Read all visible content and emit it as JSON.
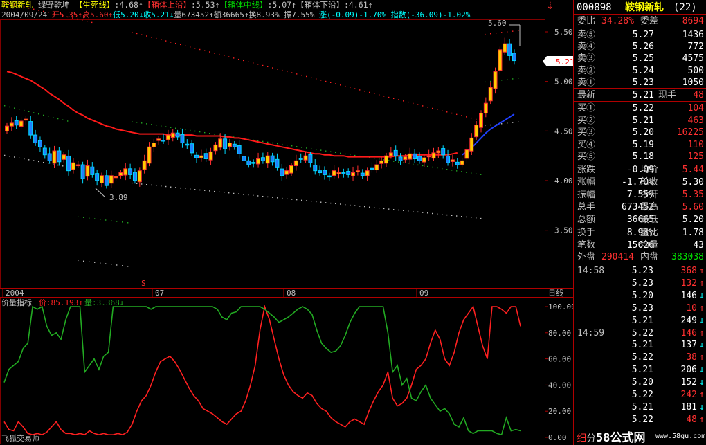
{
  "header": {
    "line1": [
      {
        "t": "鞍钢新轧",
        "c": "#ffff00"
      },
      {
        "t": "  绿野乾坤 ",
        "c": "#c0c0c0"
      },
      {
        "t": "【生死线】",
        "c": "#ffff00"
      },
      {
        "t": ":4.68↑",
        "c": "#c0c0c0"
      },
      {
        "t": "【箱体上沿】",
        "c": "#ff3030"
      },
      {
        "t": ":5.53↑",
        "c": "#c0c0c0"
      },
      {
        "t": "【箱体中线】",
        "c": "#00e000"
      },
      {
        "t": ":5.07↑",
        "c": "#c0c0c0"
      },
      {
        "t": "【箱体下沿】",
        "c": "#c0c0c0"
      },
      {
        "t": ":4.61↑",
        "c": "#c0c0c0"
      }
    ],
    "line2": [
      {
        "t": "2004/09/24 ",
        "c": "#c0c0c0"
      },
      {
        "t": "开5.35↑",
        "c": "#ff3030"
      },
      {
        "t": "高5.60↑",
        "c": "#ff3030"
      },
      {
        "t": "低5.20↓",
        "c": "#00ffff"
      },
      {
        "t": "收5.21↓",
        "c": "#00ffff"
      },
      {
        "t": "量673452↑",
        "c": "#c0c0c0"
      },
      {
        "t": "额36665↑",
        "c": "#c0c0c0"
      },
      {
        "t": "换8.93%",
        "c": "#c0c0c0"
      },
      {
        "t": " 振7.55%",
        "c": "#c0c0c0"
      },
      {
        "t": " 涨(-0.09)-1.70%",
        "c": "#00ffff"
      },
      {
        "t": " 指数(-36.09)-1.02%",
        "c": "#00ffff"
      }
    ]
  },
  "chart_data": [
    {
      "type": "candlestick",
      "title": "鞍钢新轧",
      "xlabel": "",
      "ylabel": "",
      "ylim": [
        3.2,
        5.7
      ],
      "y_ticks": [
        "5.50",
        "5.00",
        "4.50",
        "4.00",
        "3.50"
      ],
      "x_ticks": [
        "2004",
        "07",
        "08",
        "09"
      ],
      "period_label": "日线",
      "min_label": "3.89",
      "max_label": "5.60",
      "last_price_label": "5.21",
      "closes": [
        4.55,
        4.58,
        4.56,
        4.6,
        4.62,
        4.46,
        4.38,
        4.34,
        4.26,
        4.2,
        4.3,
        4.19,
        4.26,
        4.1,
        4.18,
        4.16,
        4.02,
        4.15,
        4.06,
        4.0,
        4.05,
        3.95,
        4.05,
        4.04,
        4.08,
        4.12,
        4.06,
        4.0,
        4.1,
        4.2,
        4.34,
        4.38,
        4.42,
        4.4,
        4.46,
        4.48,
        4.44,
        4.38,
        4.36,
        4.28,
        4.23,
        4.25,
        4.22,
        4.29,
        4.36,
        4.42,
        4.32,
        4.38,
        4.34,
        4.27,
        4.2,
        4.16,
        4.18,
        4.22,
        4.2,
        4.25,
        4.19,
        4.13,
        4.05,
        4.1,
        4.15,
        4.2,
        4.22,
        4.25,
        4.18,
        4.1,
        4.08,
        4.06,
        4.04,
        4.1,
        4.08,
        4.07,
        4.06,
        4.08,
        4.1,
        4.05,
        4.1,
        4.12,
        4.16,
        4.2,
        4.25,
        4.28,
        4.25,
        4.2,
        4.24,
        4.27,
        4.22,
        4.2,
        4.23,
        4.25,
        4.28,
        4.3,
        4.26,
        4.18,
        4.21,
        4.16,
        4.2,
        4.31,
        4.43,
        4.56,
        4.68,
        4.78,
        4.94,
        5.1,
        5.32,
        5.38,
        5.26,
        5.21
      ],
      "lines": [
        {
          "name": "",
          "color": "#ff1a1a",
          "values": [
            5.1,
            5.09,
            5.07,
            5.05,
            5.03,
            5.01,
            4.98,
            4.95,
            4.92,
            4.88,
            4.85,
            4.82,
            4.78,
            4.75,
            4.71,
            4.68,
            4.66,
            4.63,
            4.61,
            4.59,
            4.57,
            4.55,
            4.54,
            4.52,
            4.51,
            4.5,
            4.49,
            4.48,
            4.47,
            4.47,
            4.47,
            4.47,
            4.47,
            4.47,
            4.46,
            4.46,
            4.46,
            4.46,
            4.46,
            4.46,
            4.45,
            4.45,
            4.45,
            4.45,
            4.45,
            4.45,
            4.44,
            4.44,
            4.43,
            4.43,
            4.42,
            4.41,
            4.4,
            4.39,
            4.38,
            4.37,
            4.36,
            4.35,
            4.34,
            4.33,
            4.32,
            4.31,
            4.3,
            4.29,
            4.28,
            4.27,
            4.27,
            4.26,
            4.26,
            4.25,
            4.25,
            4.25,
            4.24,
            4.24,
            4.24,
            4.24,
            4.24,
            4.24,
            4.24,
            4.24,
            4.24,
            4.24,
            4.25,
            4.25,
            4.25,
            4.26,
            4.26,
            4.26,
            4.26,
            4.26,
            4.26,
            4.26,
            4.26,
            4.26,
            4.27,
            4.28
          ]
        },
        {
          "name": "",
          "color": "#2040ff",
          "values": [
            4.26,
            4.29,
            4.33,
            4.38,
            4.43,
            4.48,
            4.52,
            4.55,
            4.58,
            4.61,
            4.64,
            4.67
          ]
        }
      ]
    },
    {
      "type": "line",
      "title": "价量指标",
      "ylim": [
        0,
        100
      ],
      "y_ticks": [
        "100.00",
        "80.00",
        "60.00",
        "40.00",
        "20.00",
        "0.00"
      ],
      "series": [
        {
          "name": "价",
          "label": "价:85.193↑",
          "color": "#ff2020",
          "values": [
            12,
            6,
            5,
            12,
            8,
            3,
            2,
            3,
            2,
            4,
            8,
            12,
            6,
            3,
            3,
            2,
            3,
            2,
            5,
            3,
            2,
            3,
            2,
            2,
            3,
            2,
            4,
            10,
            20,
            28,
            32,
            40,
            50,
            58,
            60,
            62,
            58,
            52,
            45,
            38,
            32,
            28,
            22,
            20,
            18,
            15,
            12,
            10,
            14,
            18,
            20,
            28,
            40,
            55,
            82,
            100,
            90,
            75,
            60,
            48,
            40,
            35,
            32,
            30,
            34,
            32,
            26,
            22,
            20,
            15,
            12,
            10,
            8,
            12,
            14,
            12,
            10,
            20,
            28,
            35,
            40,
            50,
            30,
            24,
            26,
            30,
            40,
            52,
            55,
            60,
            72,
            82,
            75,
            60,
            55,
            65,
            80,
            90,
            95,
            100,
            85,
            70,
            60,
            100,
            100,
            98,
            95,
            100,
            100,
            85
          ]
        },
        {
          "name": "量",
          "label": "量:3.368↓",
          "color": "#22aa22",
          "values": [
            42,
            52,
            55,
            58,
            68,
            72,
            100,
            98,
            100,
            85,
            78,
            80,
            75,
            90,
            100,
            100,
            100,
            50,
            55,
            60,
            52,
            62,
            65,
            100,
            100,
            100,
            100,
            100,
            100,
            100,
            100,
            98,
            100,
            100,
            100,
            100,
            100,
            100,
            100,
            100,
            100,
            100,
            100,
            100,
            100,
            98,
            92,
            90,
            95,
            96,
            100,
            100,
            100,
            100,
            100,
            98,
            95,
            92,
            88,
            90,
            92,
            95,
            98,
            100,
            98,
            94,
            82,
            72,
            68,
            65,
            66,
            70,
            78,
            88,
            95,
            100,
            100,
            100,
            100,
            100,
            100,
            80,
            50,
            55,
            40,
            45,
            30,
            28,
            35,
            40,
            30,
            25,
            20,
            22,
            18,
            10,
            8,
            15,
            5,
            3,
            5,
            5,
            5,
            5,
            3,
            2,
            15,
            5,
            6,
            5
          ]
        }
      ]
    }
  ],
  "panel": {
    "code": "000898",
    "name": "鞍钢新轧",
    "count": "(22)",
    "weibi_label": "委比",
    "weibi_value": "34.28%",
    "weicha_label": "委差",
    "weicha_value": "8694",
    "asks": [
      {
        "label": "卖⑤",
        "price": "5.27",
        "vol": "1436"
      },
      {
        "label": "卖④",
        "price": "5.26",
        "vol": "772"
      },
      {
        "label": "卖③",
        "price": "5.25",
        "vol": "4575"
      },
      {
        "label": "卖②",
        "price": "5.24",
        "vol": "500"
      },
      {
        "label": "卖①",
        "price": "5.23",
        "vol": "1050"
      }
    ],
    "latest_label": "最新",
    "latest_value": "5.21",
    "xianshou_label": "现手",
    "xianshou_value": "48",
    "bids": [
      {
        "label": "买①",
        "price": "5.22",
        "vol": "104"
      },
      {
        "label": "买②",
        "price": "5.21",
        "vol": "463"
      },
      {
        "label": "买③",
        "price": "5.20",
        "vol": "16225"
      },
      {
        "label": "买④",
        "price": "5.19",
        "vol": "110"
      },
      {
        "label": "买⑤",
        "price": "5.18",
        "vol": "125"
      }
    ],
    "stats": [
      {
        "l1": "涨跌",
        "v1": "-0.09",
        "c1": "#ffffff",
        "l2": "均价",
        "v2": "5.44",
        "c2": "#ff3030"
      },
      {
        "l1": "涨幅",
        "v1": "-1.70%",
        "c1": "#ffffff",
        "l2": "前收",
        "v2": "5.30",
        "c2": "#ffffff"
      },
      {
        "l1": "振幅",
        "v1": "7.55%",
        "c1": "#ffffff",
        "l2": "今开",
        "v2": "5.35",
        "c2": "#ff3030"
      },
      {
        "l1": "总手",
        "v1": "673452",
        "c1": "#ffffff",
        "l2": "最高",
        "v2": "5.60",
        "c2": "#ff3030"
      },
      {
        "l1": "总额",
        "v1": "36665",
        "c1": "#ffffff",
        "l2": "最低",
        "v2": "5.20",
        "c2": "#ffffff"
      },
      {
        "l1": "换手",
        "v1": "8.93%",
        "c1": "#ffffff",
        "l2": "量比",
        "v2": "1.78",
        "c2": "#ffffff"
      },
      {
        "l1": "笔数",
        "v1": "15626",
        "c1": "#ffffff",
        "l2": "均量",
        "v2": "43",
        "c2": "#ffffff"
      }
    ],
    "waipan_label": "外盘",
    "waipan_value": "290414",
    "neipan_label": "内盘",
    "neipan_value": "383038",
    "ticks": [
      {
        "time": "14:58",
        "price": "5.23",
        "vol": "368",
        "dir": "up"
      },
      {
        "time": "",
        "price": "5.23",
        "vol": "132",
        "dir": "up"
      },
      {
        "time": "",
        "price": "5.20",
        "vol": "146",
        "dir": "down"
      },
      {
        "time": "",
        "price": "5.23",
        "vol": "10",
        "dir": "up"
      },
      {
        "time": "",
        "price": "5.21",
        "vol": "249",
        "dir": "down"
      },
      {
        "time": "14:59",
        "price": "5.22",
        "vol": "146",
        "dir": "up"
      },
      {
        "time": "",
        "price": "5.21",
        "vol": "137",
        "dir": "down"
      },
      {
        "time": "",
        "price": "5.22",
        "vol": "38",
        "dir": "up"
      },
      {
        "time": "",
        "price": "5.21",
        "vol": "206",
        "dir": "down"
      },
      {
        "time": "",
        "price": "5.20",
        "vol": "152",
        "dir": "down"
      },
      {
        "time": "",
        "price": "5.22",
        "vol": "242",
        "dir": "up"
      },
      {
        "time": "",
        "price": "5.21",
        "vol": "181",
        "dir": "down"
      },
      {
        "time": "",
        "price": "5.22",
        "vol": "48",
        "dir": "up"
      }
    ],
    "footer_tab": "细",
    "footer_btn": "分",
    "watermark_brand": "58公式网",
    "watermark_url": "www.58gu.com"
  },
  "footer_left": "飞狐交易师",
  "top_arrow_icon": "down-arrow-icon",
  "marker_s": "S"
}
